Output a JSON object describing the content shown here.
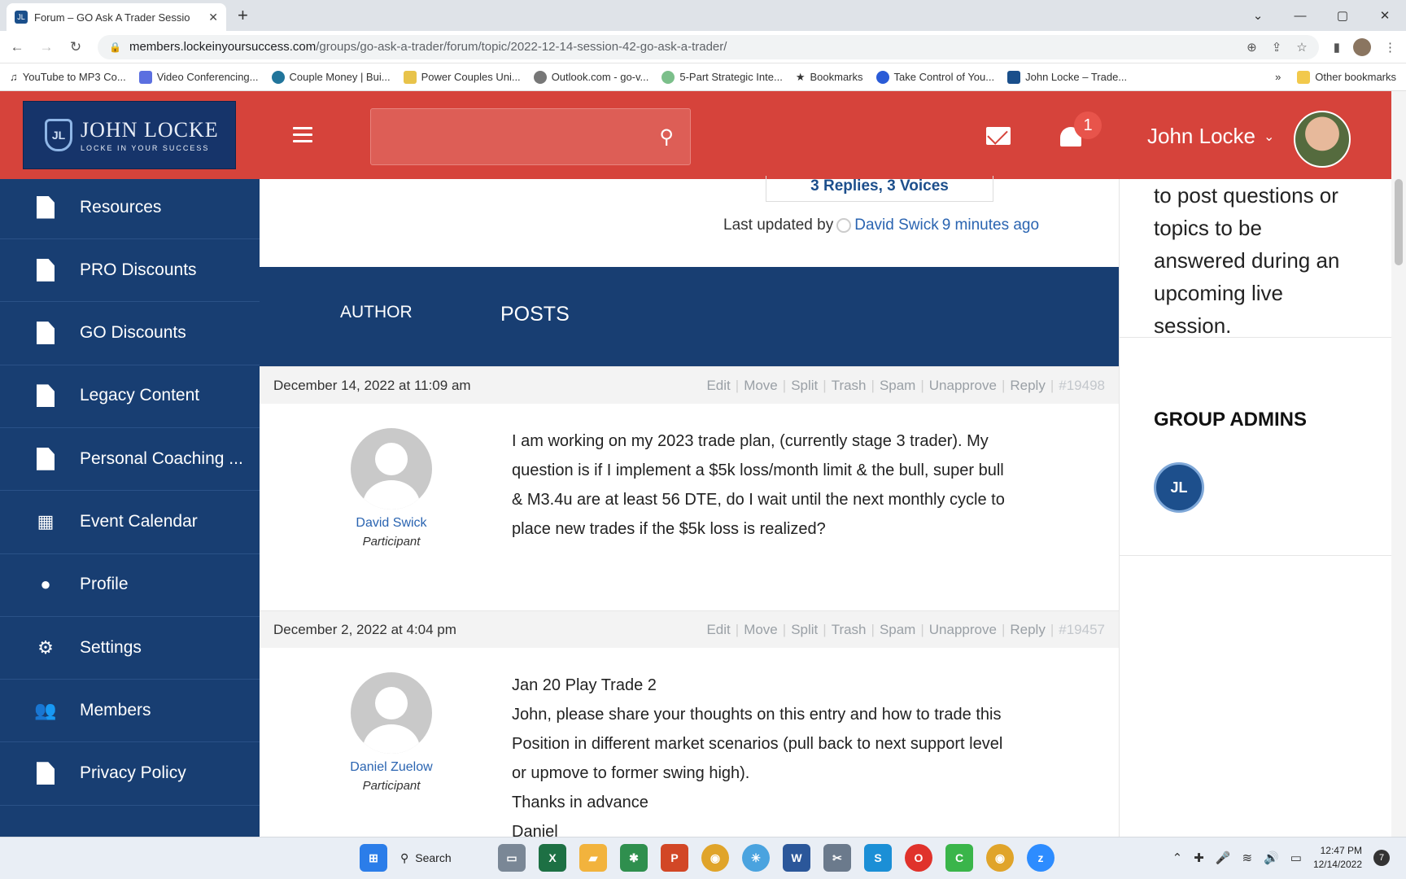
{
  "browser": {
    "tab_title": "Forum – GO Ask A Trader Sessio",
    "url_host": "members.lockeinyoursuccess.com",
    "url_path": "/groups/go-ask-a-trader/forum/topic/2022-12-14-session-42-go-ask-a-trader/",
    "bookmarks": [
      "YouTube to MP3 Co...",
      "Video Conferencing...",
      "Couple Money | Bui...",
      "Power Couples Uni...",
      "Outlook.com - go-v...",
      "5-Part Strategic Inte...",
      "Bookmarks",
      "Take Control of You...",
      "John Locke – Trade..."
    ],
    "more_bookmarks": "»",
    "other_bookmarks": "Other bookmarks"
  },
  "header": {
    "logo_name": "JOHN LOCKE",
    "logo_tagline": "LOCKE IN YOUR SUCCESS",
    "logo_mark": "JL",
    "notification_count": "1",
    "user_name": "John Locke"
  },
  "sidebar": {
    "items": [
      {
        "label": "Resources",
        "icon": "document-icon"
      },
      {
        "label": "PRO Discounts",
        "icon": "document-icon"
      },
      {
        "label": "GO Discounts",
        "icon": "document-icon"
      },
      {
        "label": "Legacy Content",
        "icon": "document-icon"
      },
      {
        "label": "Personal Coaching ...",
        "icon": "document-icon"
      },
      {
        "label": "Event Calendar",
        "icon": "calendar-icon"
      },
      {
        "label": "Profile",
        "icon": "user-icon"
      },
      {
        "label": "Settings",
        "icon": "gears-icon"
      },
      {
        "label": "Members",
        "icon": "users-icon"
      },
      {
        "label": "Privacy Policy",
        "icon": "document-icon"
      }
    ]
  },
  "topic": {
    "replies_voices": "3 Replies, 3 Voices",
    "last_updated_prefix": "Last updated by",
    "last_updated_user": "David Swick",
    "last_updated_time": "9 minutes ago",
    "col_author": "AUTHOR",
    "col_posts": "POSTS"
  },
  "post_actions": [
    "Edit",
    "Move",
    "Split",
    "Trash",
    "Spam",
    "Unapprove",
    "Reply"
  ],
  "posts": [
    {
      "date": "December 14, 2022 at 11:09 am",
      "id": "#19498",
      "author": "David Swick",
      "role": "Participant",
      "lines": [
        "I am working on my 2023 trade plan, (currently stage 3 trader). My",
        "question is if I implement a $5k loss/month limit & the bull, super bull",
        "& M3.4u are at least 56 DTE, do I wait until the next monthly cycle to",
        "place new trades if the $5k loss is realized?"
      ]
    },
    {
      "date": "December 2, 2022 at 4:04 pm",
      "id": "#19457",
      "author": "Daniel Zuelow",
      "role": "Participant",
      "lines": [
        "Jan 20 Play Trade 2",
        "John, please share your thoughts on this entry and how to trade this",
        "Position in different market scenarios (pull back to next support level",
        "or upmove to former swing high).",
        "Thanks in advance",
        "Daniel"
      ]
    }
  ],
  "aside": {
    "desc_lines": [
      "to post questions or",
      "topics to be",
      "answered during an",
      "upcoming live",
      "session."
    ],
    "group_admins_title": "GROUP ADMINS",
    "admin_mark": "JL"
  },
  "taskbar": {
    "search_label": "Search",
    "time": "12:47 PM",
    "date": "12/14/2022",
    "notification_count": "7"
  }
}
